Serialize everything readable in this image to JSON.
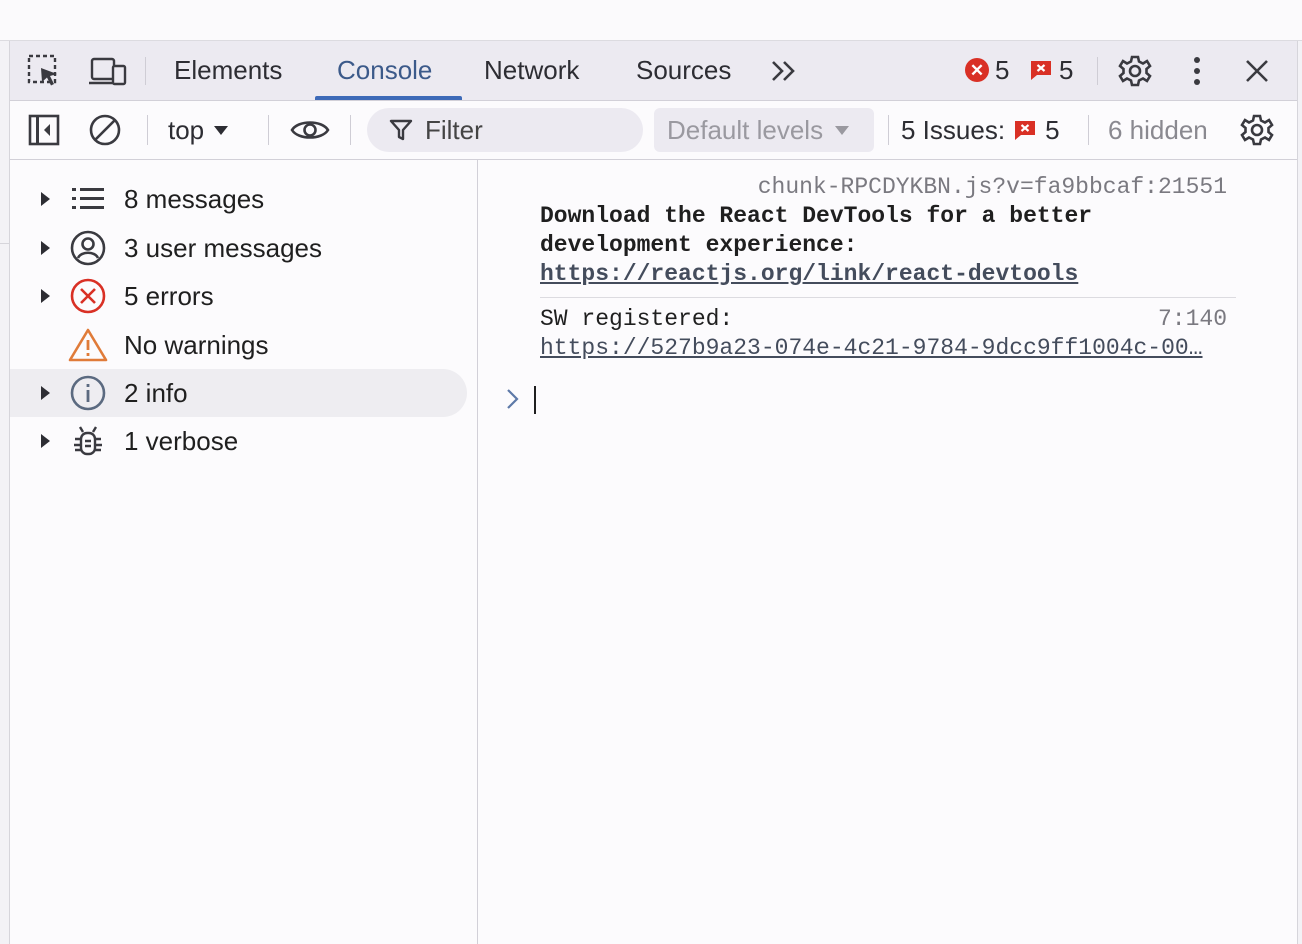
{
  "tabs": {
    "items": [
      {
        "label": "Elements"
      },
      {
        "label": "Console"
      },
      {
        "label": "Network"
      },
      {
        "label": "Sources"
      }
    ],
    "active": "Console",
    "error_count": "5",
    "issue_count": "5"
  },
  "toolbar": {
    "context": "top",
    "filter_placeholder": "Filter",
    "levels": "Default levels",
    "issues_label": "5 Issues:",
    "issues_count": "5",
    "hidden": "6 hidden"
  },
  "sidebar": {
    "items": [
      {
        "label": "8 messages",
        "icon": "list-icon"
      },
      {
        "label": "3 user messages",
        "icon": "user-icon"
      },
      {
        "label": "5 errors",
        "icon": "error-icon"
      },
      {
        "label": "No warnings",
        "icon": "warning-icon"
      },
      {
        "label": "2 info",
        "icon": "info-icon"
      },
      {
        "label": "1 verbose",
        "icon": "bug-icon"
      }
    ],
    "selected": "2 info"
  },
  "console": {
    "messages": [
      {
        "source": "chunk-RPCDYKBN.js?v=fa9bbcaf:21551",
        "line1": "Download the React DevTools for a better",
        "line2": "development experience:",
        "link": "https://reactjs.org/link/react-devtools"
      },
      {
        "source": "7:140",
        "line1": "SW registered:",
        "link": "https://527b9a23-074e-4c21-9784-9dcc9ff1004c-00…"
      }
    ]
  },
  "colors": {
    "error": "#d93025",
    "warning": "#e07b39",
    "accent": "#3d6ab8"
  }
}
